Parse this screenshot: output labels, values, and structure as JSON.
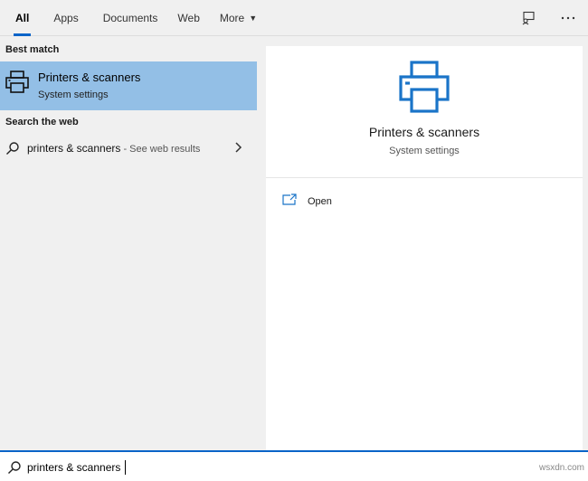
{
  "tabs": [
    {
      "label": "All",
      "active": true
    },
    {
      "label": "Apps"
    },
    {
      "label": "Documents"
    },
    {
      "label": "Web"
    },
    {
      "label": "More"
    }
  ],
  "top_icons": [
    "feedback-icon",
    "more-options-icon"
  ],
  "left": {
    "best_match_label": "Best match",
    "best_match": {
      "title": "Printers & scanners",
      "subtitle": "System settings",
      "icon": "printer-icon"
    },
    "search_web_label": "Search the web",
    "web_result": {
      "query": "printers & scanners",
      "suffix": " - See web results"
    }
  },
  "right": {
    "title": "Printers & scanners",
    "subtitle": "System settings",
    "actions": [
      {
        "label": "Open",
        "icon": "open-window-icon"
      }
    ]
  },
  "search": {
    "value": "printers & scanners"
  },
  "watermark": "wsxdn.com",
  "colors": {
    "accent": "#0a64c8",
    "selection": "#93bfe6",
    "icon_blue": "#1a74c8"
  }
}
